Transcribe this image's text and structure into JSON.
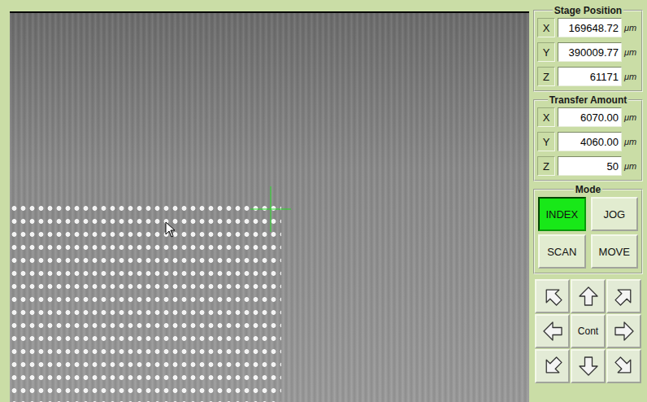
{
  "stage_position": {
    "title": "Stage Position",
    "rows": [
      {
        "axis": "X",
        "value": "169648.72",
        "unit": "μm"
      },
      {
        "axis": "Y",
        "value": "390009.77",
        "unit": "μm"
      },
      {
        "axis": "Z",
        "value": "61171",
        "unit": "μm"
      }
    ]
  },
  "transfer_amount": {
    "title": "Transfer Amount",
    "rows": [
      {
        "axis": "X",
        "value": "6070.00",
        "unit": "μm"
      },
      {
        "axis": "Y",
        "value": "4060.00",
        "unit": "μm"
      },
      {
        "axis": "Z",
        "value": "50",
        "unit": "μm"
      }
    ]
  },
  "mode": {
    "title": "Mode",
    "buttons": [
      {
        "label": "INDEX",
        "selected": true
      },
      {
        "label": "JOG",
        "selected": false
      },
      {
        "label": "SCAN",
        "selected": false
      },
      {
        "label": "MOVE",
        "selected": false
      }
    ]
  },
  "jog_pad": {
    "center_label": "Cont"
  }
}
